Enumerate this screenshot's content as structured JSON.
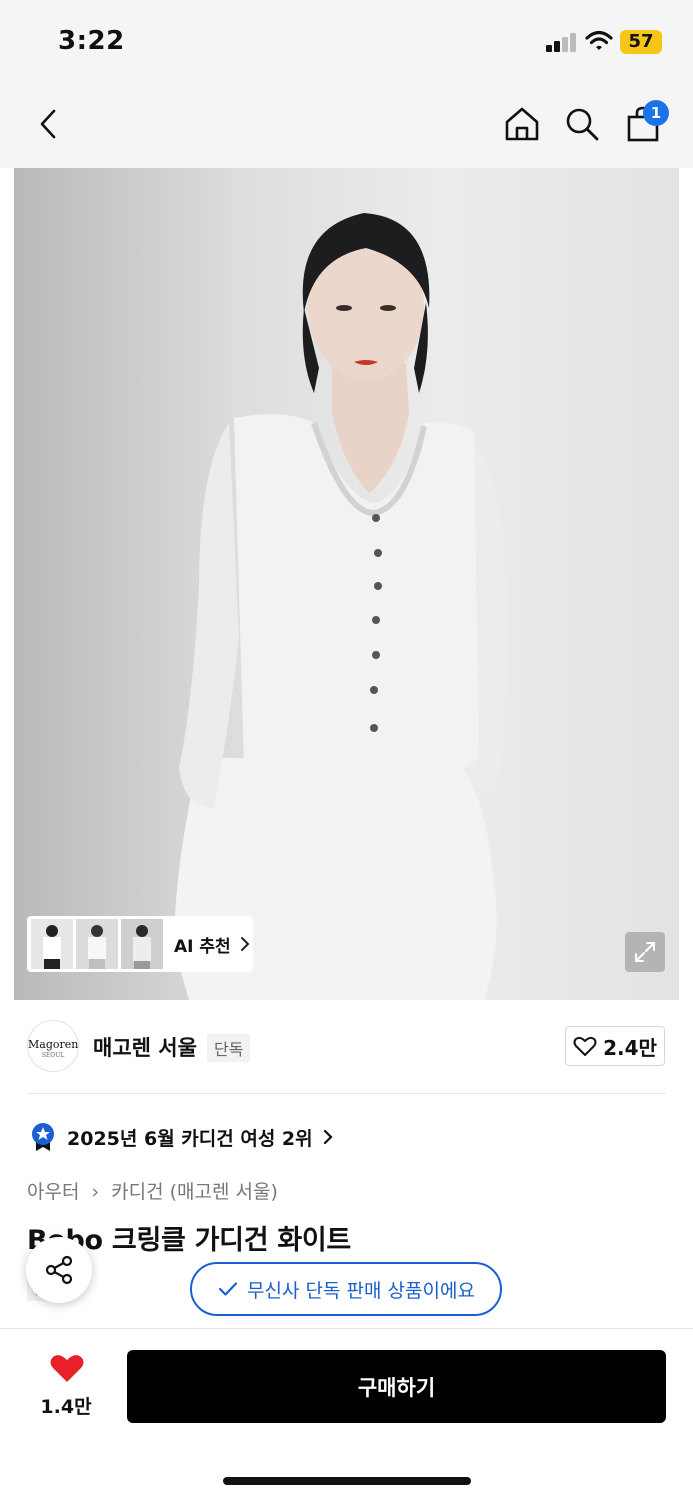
{
  "status_bar": {
    "time": "3:22",
    "battery": "57"
  },
  "nav": {
    "cart_count": "1"
  },
  "hero": {
    "ai_recommend_label": "AI 추천"
  },
  "brand": {
    "logo_text": "Magoren",
    "logo_subtext": "SEOUL",
    "name": "매고렌 서울",
    "tag": "단독",
    "likes": "2.4만"
  },
  "ranking": {
    "text": "2025년 6월 카디건 여성 2위"
  },
  "breadcrumb": {
    "category": "아우터",
    "subcategory": "카디건 (매고렌 서울)"
  },
  "product": {
    "title": "Bobo 크링클 가디건 화이트",
    "exclusive_tag": "단독"
  },
  "toast": {
    "text": "무신사 단독 판매 상품이에요"
  },
  "bottom_bar": {
    "like_count": "1.4만",
    "buy_label": "구매하기"
  },
  "colors": {
    "accent_blue": "#1a5fd0",
    "badge_blue": "#1a73e8",
    "heart_red": "#e8202a",
    "battery_yellow": "#f5c518"
  }
}
